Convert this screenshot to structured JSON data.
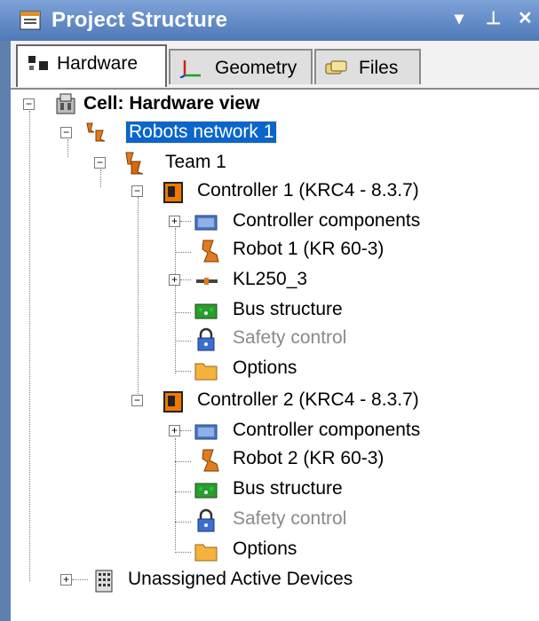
{
  "window": {
    "title": "Project Structure",
    "buttons": [
      "▾",
      "⊥",
      "✕"
    ]
  },
  "tabs": [
    {
      "label": "Hardware",
      "active": true,
      "icon": "hardware-icon"
    },
    {
      "label": "Geometry",
      "active": false,
      "icon": "geometry-axes-icon"
    },
    {
      "label": "Files",
      "active": false,
      "icon": "files-icon"
    }
  ],
  "tree": {
    "cell": "Cell: Hardware view",
    "robots_network": "Robots network 1",
    "team": "Team 1",
    "controller1": {
      "label": "Controller 1 (KRC4 - 8.3.7)",
      "components": "Controller components",
      "robot": "Robot 1 (KR 60-3)",
      "kl": "KL250_3",
      "bus": "Bus structure",
      "safety": "Safety control",
      "options": "Options"
    },
    "controller2": {
      "label": "Controller 2 (KRC4 - 8.3.7)",
      "components": "Controller components",
      "robot": "Robot 2 (KR 60-3)",
      "bus": "Bus structure",
      "safety": "Safety control",
      "options": "Options"
    },
    "unassigned": "Unassigned Active Devices"
  },
  "colors": {
    "titlebar": "#5a86c5",
    "selection": "#0a65cc",
    "robot_orange": "#e07b1f",
    "controller_orange": "#f07800"
  }
}
